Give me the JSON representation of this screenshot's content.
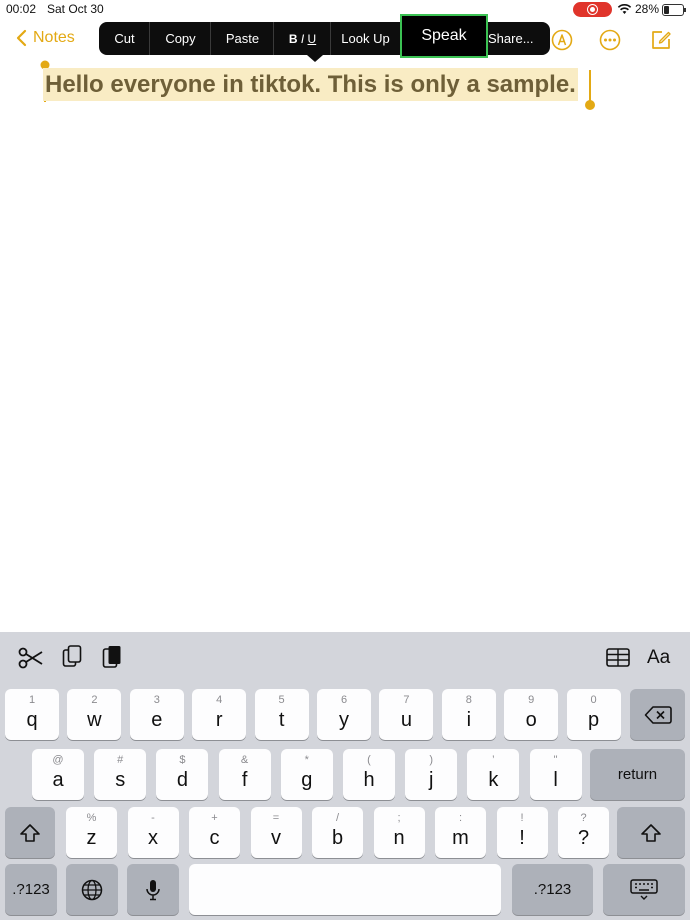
{
  "status_bar": {
    "time": "00:02",
    "date": "Sat Oct 30",
    "battery": "28%",
    "battery_level": 0.28
  },
  "nav": {
    "back_label": "Notes",
    "icons": [
      "chevron-left-icon",
      "markup-icon",
      "more-icon",
      "compose-icon"
    ]
  },
  "edit_menu": {
    "items": [
      {
        "key": "cut",
        "label": "Cut"
      },
      {
        "key": "copy",
        "label": "Copy"
      },
      {
        "key": "paste",
        "label": "Paste"
      },
      {
        "key": "biu",
        "label": "B I U"
      },
      {
        "key": "look_up",
        "label": "Look Up"
      },
      {
        "key": "speak",
        "label": "Speak"
      },
      {
        "key": "share",
        "label": "Share..."
      }
    ]
  },
  "note": {
    "text": "Hello everyone in tiktok. This is only a sample."
  },
  "keyboard": {
    "toolbar": {
      "icons": [
        "scissors-icon",
        "copy-icon",
        "paste-icon",
        "table-icon",
        "format-icon"
      ],
      "format_label": "Aa"
    },
    "row1": [
      {
        "p": "q",
        "s": "1"
      },
      {
        "p": "w",
        "s": "2"
      },
      {
        "p": "e",
        "s": "3"
      },
      {
        "p": "r",
        "s": "4"
      },
      {
        "p": "t",
        "s": "5"
      },
      {
        "p": "y",
        "s": "6"
      },
      {
        "p": "u",
        "s": "7"
      },
      {
        "p": "i",
        "s": "8"
      },
      {
        "p": "o",
        "s": "9"
      },
      {
        "p": "p",
        "s": "0"
      }
    ],
    "row2": [
      {
        "p": "a",
        "s": "@"
      },
      {
        "p": "s",
        "s": "#"
      },
      {
        "p": "d",
        "s": "$"
      },
      {
        "p": "f",
        "s": "&"
      },
      {
        "p": "g",
        "s": "*"
      },
      {
        "p": "h",
        "s": "("
      },
      {
        "p": "j",
        "s": ")"
      },
      {
        "p": "k",
        "s": "’"
      },
      {
        "p": "l",
        "s": "\""
      }
    ],
    "row3": [
      {
        "p": "z",
        "s": "%"
      },
      {
        "p": "x",
        "s": "-"
      },
      {
        "p": "c",
        "s": "+"
      },
      {
        "p": "v",
        "s": "="
      },
      {
        "p": "b",
        "s": "/"
      },
      {
        "p": "n",
        "s": ";"
      },
      {
        "p": "m",
        "s": ":"
      },
      {
        "p": "!",
        "s": "!"
      },
      {
        "p": "?",
        "s": "?"
      }
    ],
    "return_label": "return",
    "numbers_label": ".?123"
  }
}
